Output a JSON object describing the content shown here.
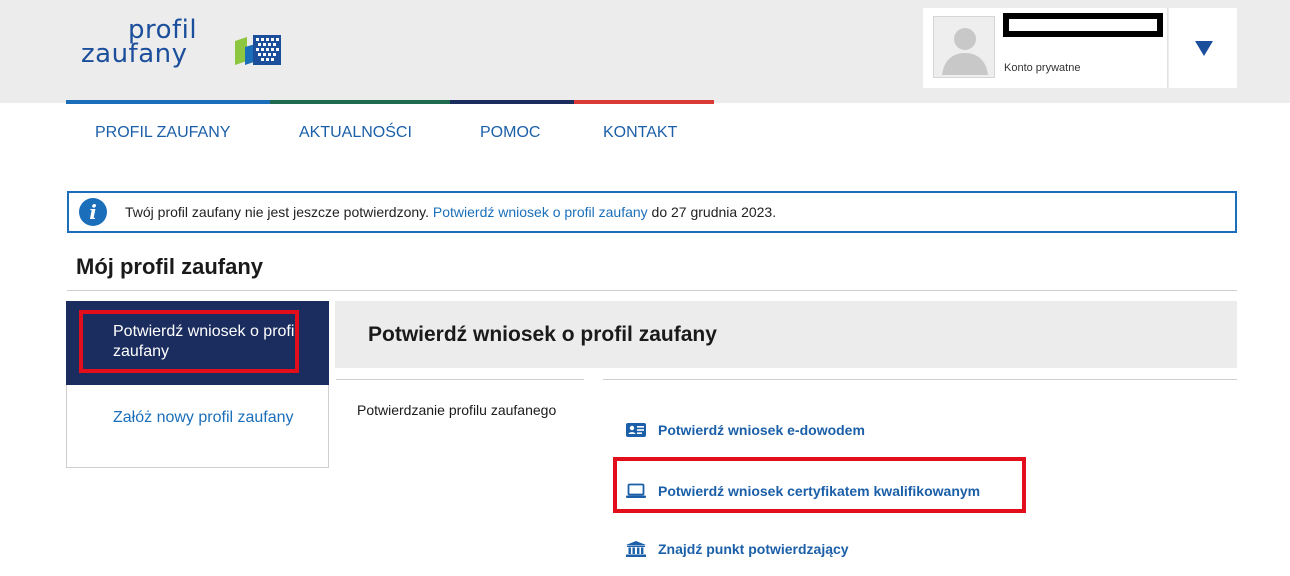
{
  "logo": {
    "line1": "profil",
    "line2": "zaufany"
  },
  "account": {
    "type_label": "Konto prywatne"
  },
  "nav": [
    {
      "label": "PROFIL ZAUFANY"
    },
    {
      "label": "AKTUALNOŚCI"
    },
    {
      "label": "POMOC"
    },
    {
      "label": "KONTAKT"
    }
  ],
  "info": {
    "text_before": "Twój profil zaufany nie jest jeszcze potwierdzony. ",
    "link": "Potwierdź wniosek o profil zaufany",
    "text_after": " do 27 grudnia 2023."
  },
  "page_title": "Mój profil zaufany",
  "side_menu": [
    {
      "label": "Potwierdź wniosek o profil zaufany"
    },
    {
      "label": "Załóż nowy profil zaufany"
    }
  ],
  "content": {
    "heading": "Potwierdź wniosek o profil zaufany",
    "section_label": "Potwierdzanie profilu zaufanego",
    "options": [
      {
        "label": "Potwierdź wniosek e-dowodem",
        "icon": "id-card-icon"
      },
      {
        "label": "Potwierdź wniosek certyfikatem kwalifikowanym",
        "icon": "laptop-icon"
      },
      {
        "label": "Znajdź punkt potwierdzający",
        "icon": "bank-building-icon"
      }
    ]
  },
  "colors": {
    "brand_blue": "#1b5fa8",
    "active_menu": "#1b2d5e",
    "highlight_red": "#e30e1c",
    "bar_blue": "#1b6fba",
    "bar_green": "#1f6b4f",
    "bar_navy": "#1b2d5e",
    "bar_red": "#d93a35"
  }
}
